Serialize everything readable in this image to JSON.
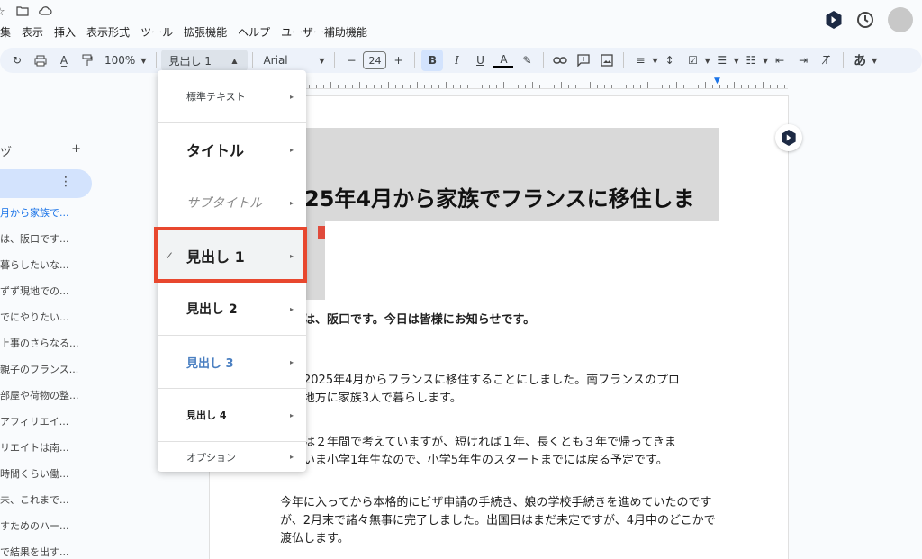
{
  "menubar": {
    "items": [
      "集",
      "表示",
      "挿入",
      "表示形式",
      "ツール",
      "拡張機能",
      "ヘルプ",
      "ユーザー補助機能"
    ]
  },
  "toolbar": {
    "zoom": "100%",
    "style": "見出し 1",
    "font": "Arial",
    "font_size": "24",
    "bold": "B",
    "italic": "I",
    "underline": "U",
    "text_color": "A",
    "input_tool": "あ"
  },
  "sidebar": {
    "head_label": "ヅ",
    "add": "+",
    "kebab": "⋮",
    "items": [
      "月から家族で...",
      "は、阪口です...",
      "暮らしたいな...",
      "ずず現地での...",
      "でにやりたい...",
      "上事のさらなる...",
      "親子のフランス...",
      "部屋や荷物の整...",
      "アフィリエイ...",
      "リエイトは南...",
      "時間くらい働...",
      "未、これまで...",
      "すためのハー...",
      "で結果を出す..."
    ]
  },
  "document": {
    "heading": "25年4月から家族でフランスに移住しま",
    "greeting": "こちは、阪口です。今日は皆様にお知らせです。",
    "p1_l1": "家、2025年4月からフランスに移住することにしました。南フランスのプロ",
    "p1_l2": "ンス地方に家族3人で暮らします。",
    "p2_l1": "期間は２年間で考えていますが、短ければ１年、長くとも３年で帰ってきま",
    "p2_l2": "娘がいま小学1年生なので、小学5年生のスタートまでには戻る予定です。",
    "p3_l1": "今年に入ってから本格的にビザ申請の手続き、娘の学校手続きを進めていたのです",
    "p3_l2": "が、2月末で諸々無事に完了しました。出国日はまだ未定ですが、4月中のどこかで",
    "p3_l3": "渡仏します。"
  },
  "dropdown": {
    "normal": "標準テキスト",
    "title": "タイトル",
    "subtitle": "サブタイトル",
    "h1": "見出し 1",
    "h2": "見出し 2",
    "h3": "見出し 3",
    "h4": "見出し 4",
    "options": "オプション",
    "check": "✓",
    "arrow": "▸"
  },
  "colors": {
    "highlight": "#e8472e",
    "heading3": "#4a7fc1",
    "accent": "#1a73e8"
  }
}
